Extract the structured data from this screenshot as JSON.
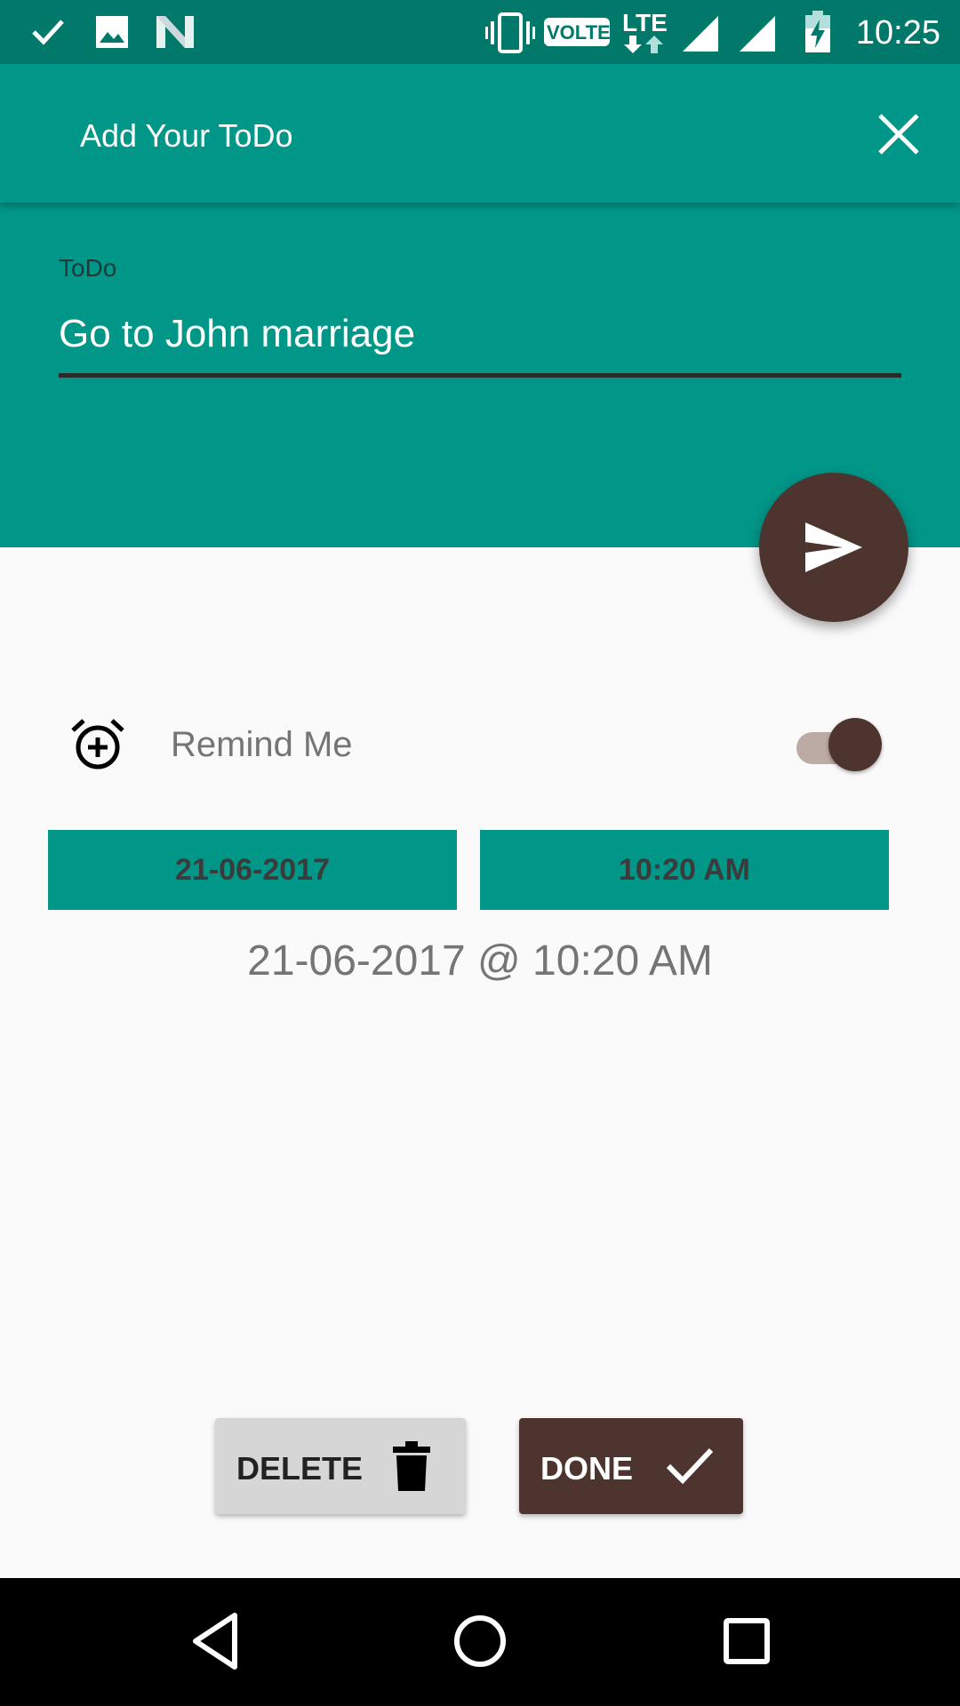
{
  "status_bar": {
    "time": "10:25",
    "volte": "VOLTE",
    "lte": "LTE",
    "icons": [
      "check-icon",
      "image-icon",
      "n-icon",
      "vibrate-icon",
      "volte-icon",
      "lte-icon",
      "signal-icon",
      "signal-icon",
      "battery-charging-icon"
    ]
  },
  "app_bar": {
    "title": "Add Your ToDo",
    "close_icon": "close-icon"
  },
  "todo_field": {
    "label": "ToDo",
    "value": "Go to John marriage"
  },
  "fab": {
    "icon": "send-icon"
  },
  "reminder": {
    "icon": "alarm-add-icon",
    "label": "Remind Me",
    "enabled": true
  },
  "date_button": {
    "label": "21-06-2017"
  },
  "time_button": {
    "label": "10:20 AM"
  },
  "summary": "21-06-2017 @ 10:20 AM",
  "actions": {
    "delete_label": "DELETE",
    "done_label": "DONE"
  },
  "colors": {
    "primary": "#009688",
    "primary_dark": "#00796b",
    "accent": "#4e342e",
    "background": "#fafafa"
  }
}
